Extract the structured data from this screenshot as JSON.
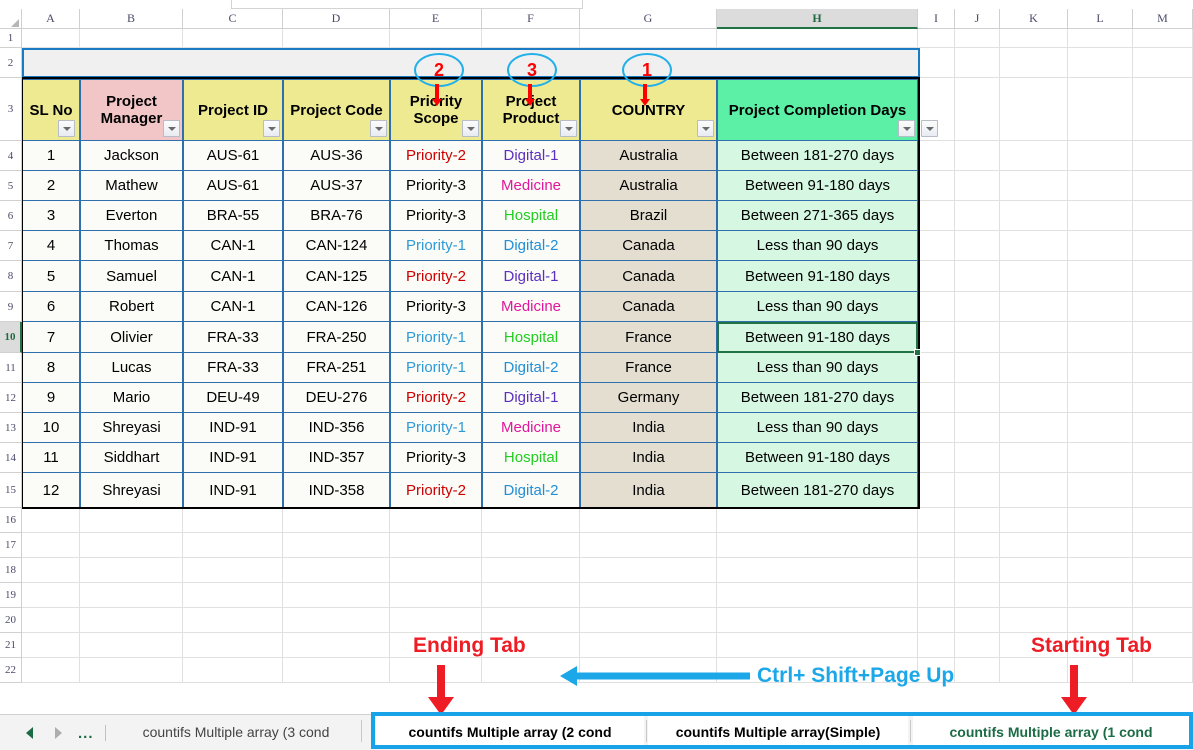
{
  "app": {
    "name": "Excel Worksheet"
  },
  "grid": {
    "column_letters": [
      "A",
      "B",
      "C",
      "D",
      "E",
      "F",
      "G",
      "H",
      "I",
      "J",
      "K",
      "L",
      "M"
    ],
    "active_column": "H",
    "row_numbers": [
      "1",
      "2",
      "3",
      "4",
      "5",
      "6",
      "7",
      "8",
      "9",
      "10",
      "11",
      "12",
      "13",
      "14",
      "15",
      "16",
      "17",
      "18",
      "19",
      "20",
      "21",
      "22"
    ],
    "active_row": "10"
  },
  "table": {
    "headers": [
      {
        "label": "SL No",
        "color": "hdr-yellow"
      },
      {
        "label": "Project Manager",
        "color": "hdr-pink"
      },
      {
        "label": "Project ID",
        "color": "hdr-yellow"
      },
      {
        "label": "Project Code",
        "color": "hdr-yellow"
      },
      {
        "label": "Priority Scope",
        "color": "hdr-yellow"
      },
      {
        "label": "Project Product",
        "color": "hdr-yellow"
      },
      {
        "label": "COUNTRY",
        "color": "hdr-yellow"
      },
      {
        "label": "Project Completion Days",
        "color": "hdr-green"
      }
    ],
    "rows": [
      {
        "sl": "1",
        "manager": "Jackson",
        "pid": "AUS-61",
        "code": "AUS-36",
        "priority": "Priority-2",
        "priority_color": "t-red",
        "product": "Digital-1",
        "product_color": "t-purple",
        "country": "Australia",
        "days": "Between 181-270 days"
      },
      {
        "sl": "2",
        "manager": "Mathew",
        "pid": "AUS-61",
        "code": "AUS-37",
        "priority": "Priority-3",
        "priority_color": "t-black",
        "product": "Medicine",
        "product_color": "t-magenta",
        "country": "Australia",
        "days": "Between 91-180 days"
      },
      {
        "sl": "3",
        "manager": "Everton",
        "pid": "BRA-55",
        "code": "BRA-76",
        "priority": "Priority-3",
        "priority_color": "t-black",
        "product": "Hospital",
        "product_color": "t-green",
        "country": "Brazil",
        "days": "Between 271-365 days"
      },
      {
        "sl": "4",
        "manager": "Thomas",
        "pid": "CAN-1",
        "code": "CAN-124",
        "priority": "Priority-1",
        "priority_color": "t-blue",
        "product": "Digital-2",
        "product_color": "t-dblue",
        "country": "Canada",
        "days": "Less than 90 days"
      },
      {
        "sl": "5",
        "manager": "Samuel",
        "pid": "CAN-1",
        "code": "CAN-125",
        "priority": "Priority-2",
        "priority_color": "t-red",
        "product": "Digital-1",
        "product_color": "t-purple",
        "country": "Canada",
        "days": "Between 91-180 days"
      },
      {
        "sl": "6",
        "manager": "Robert",
        "pid": "CAN-1",
        "code": "CAN-126",
        "priority": "Priority-3",
        "priority_color": "t-black",
        "product": "Medicine",
        "product_color": "t-magenta",
        "country": "Canada",
        "days": "Less than 90 days"
      },
      {
        "sl": "7",
        "manager": "Olivier",
        "pid": "FRA-33",
        "code": "FRA-250",
        "priority": "Priority-1",
        "priority_color": "t-blue",
        "product": "Hospital",
        "product_color": "t-green",
        "country": "France",
        "days": "Between 91-180 days"
      },
      {
        "sl": "8",
        "manager": "Lucas",
        "pid": "FRA-33",
        "code": "FRA-251",
        "priority": "Priority-1",
        "priority_color": "t-blue",
        "product": "Digital-2",
        "product_color": "t-dblue",
        "country": "France",
        "days": "Less than 90 days"
      },
      {
        "sl": "9",
        "manager": "Mario",
        "pid": "DEU-49",
        "code": "DEU-276",
        "priority": "Priority-2",
        "priority_color": "t-red",
        "product": "Digital-1",
        "product_color": "t-purple",
        "country": "Germany",
        "days": "Between 181-270 days"
      },
      {
        "sl": "10",
        "manager": "Shreyasi",
        "pid": "IND-91",
        "code": "IND-356",
        "priority": "Priority-1",
        "priority_color": "t-blue",
        "product": "Medicine",
        "product_color": "t-magenta",
        "country": "India",
        "days": "Less than 90 days"
      },
      {
        "sl": "11",
        "manager": "Siddhart",
        "pid": "IND-91",
        "code": "IND-357",
        "priority": "Priority-3",
        "priority_color": "t-black",
        "product": "Hospital",
        "product_color": "t-green",
        "country": "India",
        "days": "Between 91-180 days"
      },
      {
        "sl": "12",
        "manager": "Shreyasi",
        "pid": "IND-91",
        "code": "IND-358",
        "priority": "Priority-2",
        "priority_color": "t-red",
        "product": "Digital-2",
        "product_color": "t-dblue",
        "country": "India",
        "days": "Between 181-270 days"
      }
    ]
  },
  "annotations": {
    "circles": [
      {
        "text": "2",
        "target": "Priority Scope"
      },
      {
        "text": "3",
        "target": "Project Product"
      },
      {
        "text": "1",
        "target": "COUNTRY"
      }
    ],
    "ending_tab_label": "Ending Tab",
    "starting_tab_label": "Starting Tab",
    "shortcut_label": "Ctrl+ Shift+Page Up"
  },
  "tabbar": {
    "nav_prev": "◀",
    "nav_next": "▶",
    "nav_more": "...",
    "tabs": [
      {
        "label": "countifs Multiple array (3 cond",
        "state": "inactive"
      },
      {
        "label": "countifs Multiple array (2 cond",
        "state": "sel-white"
      },
      {
        "label": "countifs Multiple array(Simple)",
        "state": "sel-white"
      },
      {
        "label": "countifs Multiple array (1 cond",
        "state": "sel-green"
      }
    ]
  },
  "colors": {
    "header_yellow": "#eeea92",
    "header_pink": "#f2c6c6",
    "header_green": "#5bf0a5",
    "data_khaki": "#e3ded0",
    "data_mint": "#d6f7e2",
    "annotation_red": "#ee1c25",
    "annotation_blue": "#18a2e8",
    "excel_green": "#217346",
    "table_border_blue": "#2f6fad"
  }
}
